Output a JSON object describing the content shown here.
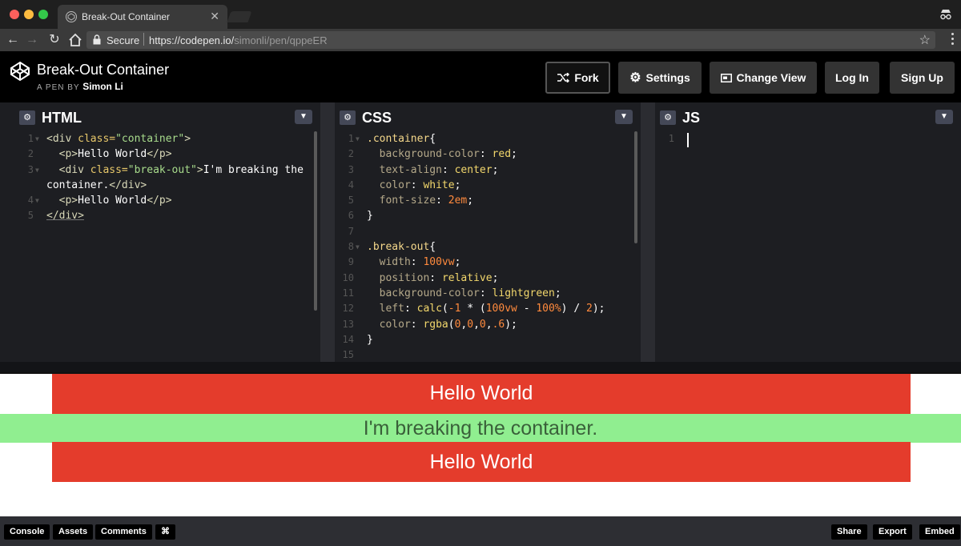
{
  "browser": {
    "tab_title": "Break-Out Container",
    "secure_label": "Secure",
    "url_host": "https://codepen.io/",
    "url_path": "simonli/pen/qppeER"
  },
  "pen": {
    "title": "Break-Out Container",
    "byline_prefix": "A PEN BY",
    "author": "Simon Li"
  },
  "header_buttons": {
    "fork": "Fork",
    "settings": "Settings",
    "change_view": "Change View",
    "login": "Log In",
    "signup": "Sign Up"
  },
  "editors": {
    "html": {
      "title": "HTML",
      "line_numbers": [
        "1",
        "2",
        "3",
        "",
        "4",
        "5"
      ]
    },
    "css": {
      "title": "CSS",
      "line_numbers": [
        "1",
        "2",
        "3",
        "4",
        "5",
        "6",
        "7",
        "8",
        "9",
        "10",
        "11",
        "12",
        "13",
        "14",
        "15"
      ]
    },
    "js": {
      "title": "JS",
      "line_numbers": [
        "1"
      ]
    }
  },
  "html_code": {
    "l1_open": "<div ",
    "l1_attr": "class=",
    "l1_str": "\"container\"",
    "l1_close": ">",
    "l2_open": "<p>",
    "l2_text": "Hello World",
    "l2_close": "</p>",
    "l3_open": "<div ",
    "l3_attr": "class=",
    "l3_str": "\"break-out\"",
    "l3_gt": ">",
    "l3_text": "I'm breaking the",
    "l3b_text": "container.",
    "l3b_close": "</div>",
    "l4_open": "<p>",
    "l4_text": "Hello World",
    "l4_close": "</p>",
    "l5_close": "</div>"
  },
  "css_code": {
    "sel1": ".container",
    "brace_open": "{",
    "brace_close": "}",
    "p_bg": "background-color",
    "v_red": "red",
    "p_align": "text-align",
    "v_center": "center",
    "p_color": "color",
    "v_white": "white",
    "p_fontsize": "font-size",
    "v_2em": "2em",
    "sel2": ".break-out",
    "p_width": "width",
    "v_100vw": "100vw",
    "p_position": "position",
    "v_relative": "relative",
    "v_lightgreen": "lightgreen",
    "p_left": "left",
    "v_calc": "calc",
    "v_calc_open": "(",
    "v_neg1": "-1",
    "v_star": " * (",
    "v_100vw2": "100vw",
    "v_minus": " - ",
    "v_100pct": "100%",
    "v_div": ") / ",
    "v_2": "2",
    "v_end": ");",
    "v_rgba": "rgba",
    "v_rgba_args_open": "(",
    "v_0a": "0",
    "v_comma": ",",
    "v_0b": "0",
    "v_0c": "0",
    "v_06": ".6",
    "colon": ": ",
    "semi": ";"
  },
  "preview": {
    "hello1": "Hello World",
    "breakout": "I'm breaking the container.",
    "hello2": "Hello World"
  },
  "footer": {
    "console": "Console",
    "assets": "Assets",
    "comments": "Comments",
    "shortcut": "⌘",
    "share": "Share",
    "export": "Export",
    "embed": "Embed"
  },
  "colors": {
    "container_bg": "#e43c2c",
    "breakout_bg": "#90ee90",
    "editor_bg": "#1d1e22",
    "header_bg": "#000000"
  }
}
